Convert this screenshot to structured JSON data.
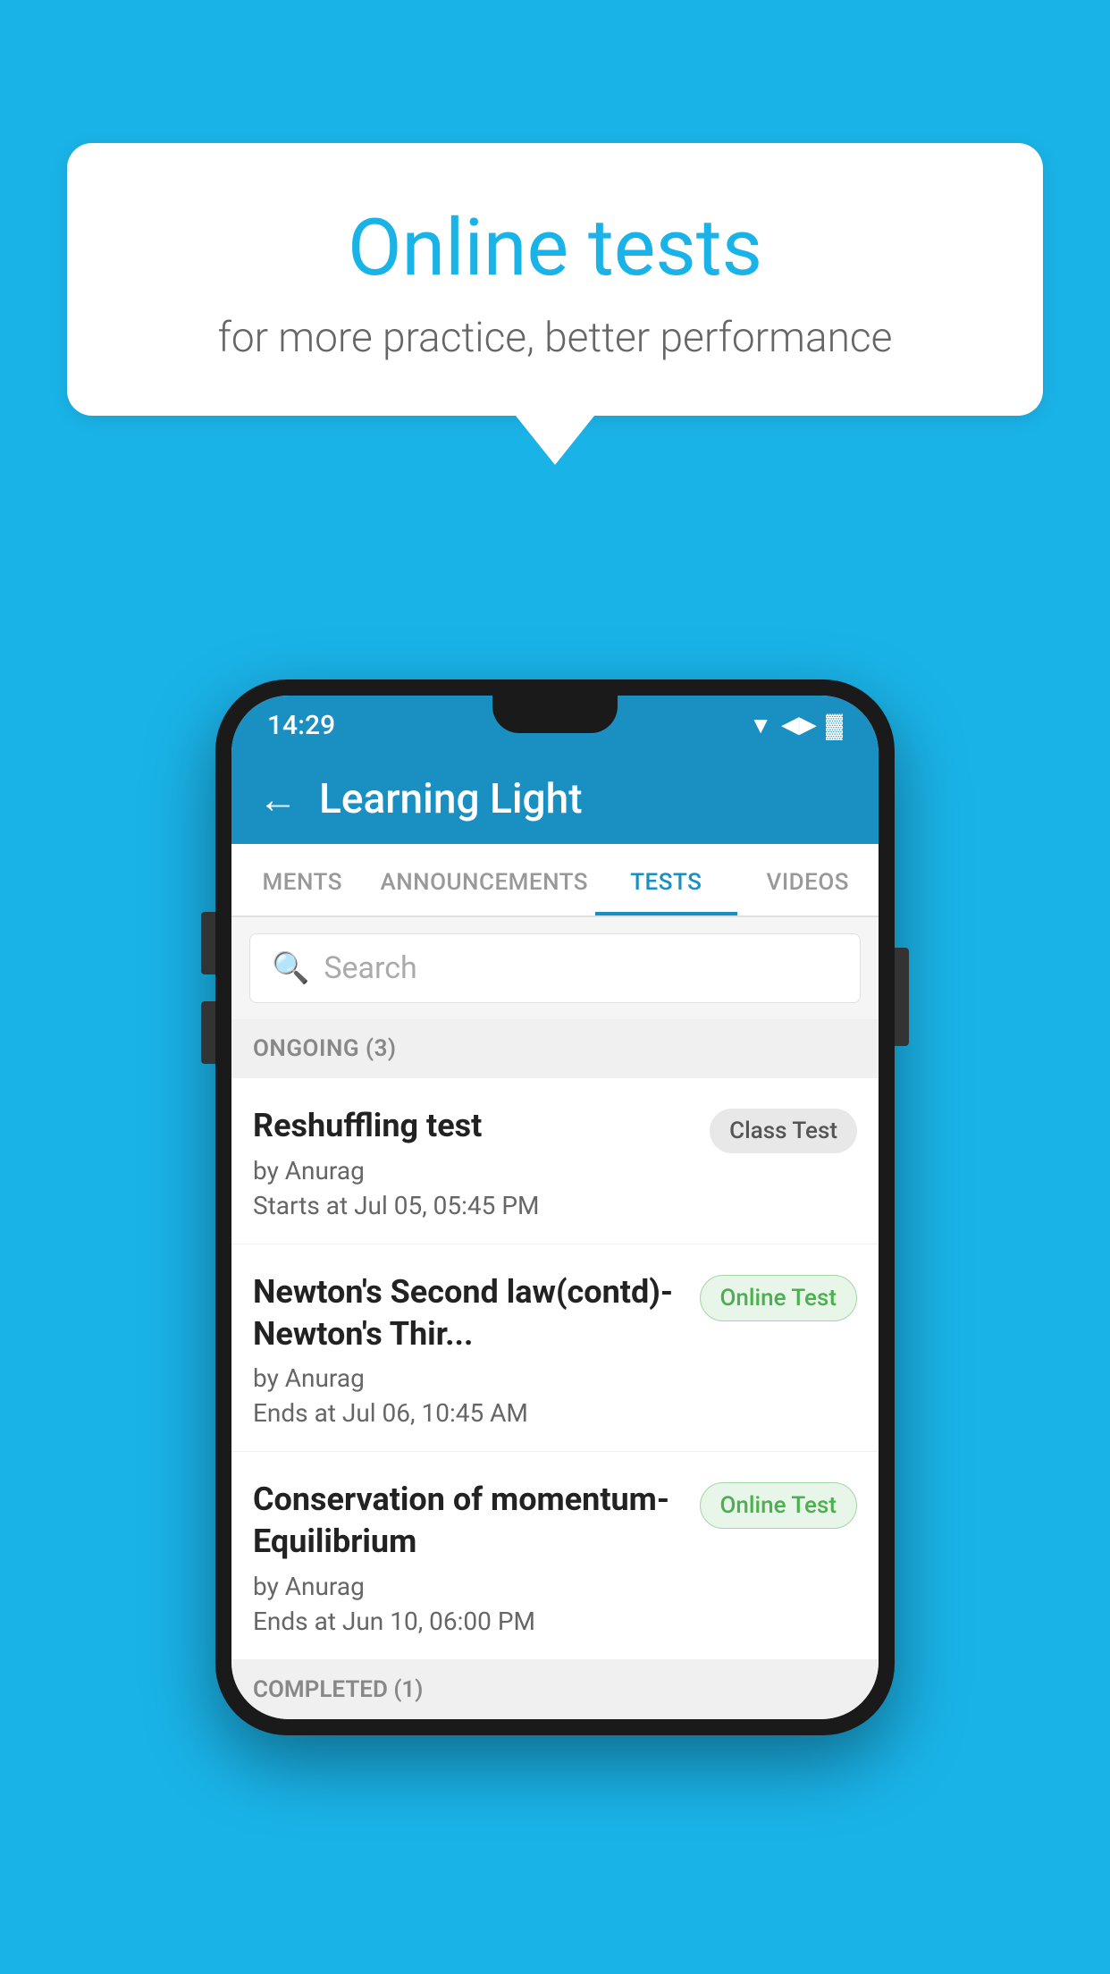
{
  "background": {
    "color": "#1ab3e8"
  },
  "speech_bubble": {
    "title": "Online tests",
    "subtitle": "for more practice, better performance"
  },
  "status_bar": {
    "time": "14:29",
    "icons": {
      "wifi": "▼",
      "signal": "▲",
      "battery": "▐"
    }
  },
  "app_bar": {
    "back_label": "←",
    "title": "Learning Light"
  },
  "tabs": [
    {
      "label": "MENTS",
      "active": false
    },
    {
      "label": "ANNOUNCEMENTS",
      "active": false
    },
    {
      "label": "TESTS",
      "active": true
    },
    {
      "label": "VIDEOS",
      "active": false
    }
  ],
  "search": {
    "placeholder": "Search"
  },
  "ongoing_section": {
    "label": "ONGOING (3)"
  },
  "tests": [
    {
      "name": "Reshuffling test",
      "author": "by Anurag",
      "time_label": "Starts at",
      "time": "Jul 05, 05:45 PM",
      "badge": "Class Test",
      "badge_type": "class"
    },
    {
      "name": "Newton's Second law(contd)-Newton's Thir...",
      "author": "by Anurag",
      "time_label": "Ends at",
      "time": "Jul 06, 10:45 AM",
      "badge": "Online Test",
      "badge_type": "online"
    },
    {
      "name": "Conservation of momentum-Equilibrium",
      "author": "by Anurag",
      "time_label": "Ends at",
      "time": "Jun 10, 06:00 PM",
      "badge": "Online Test",
      "badge_type": "online"
    }
  ],
  "completed_section": {
    "label": "COMPLETED (1)"
  }
}
